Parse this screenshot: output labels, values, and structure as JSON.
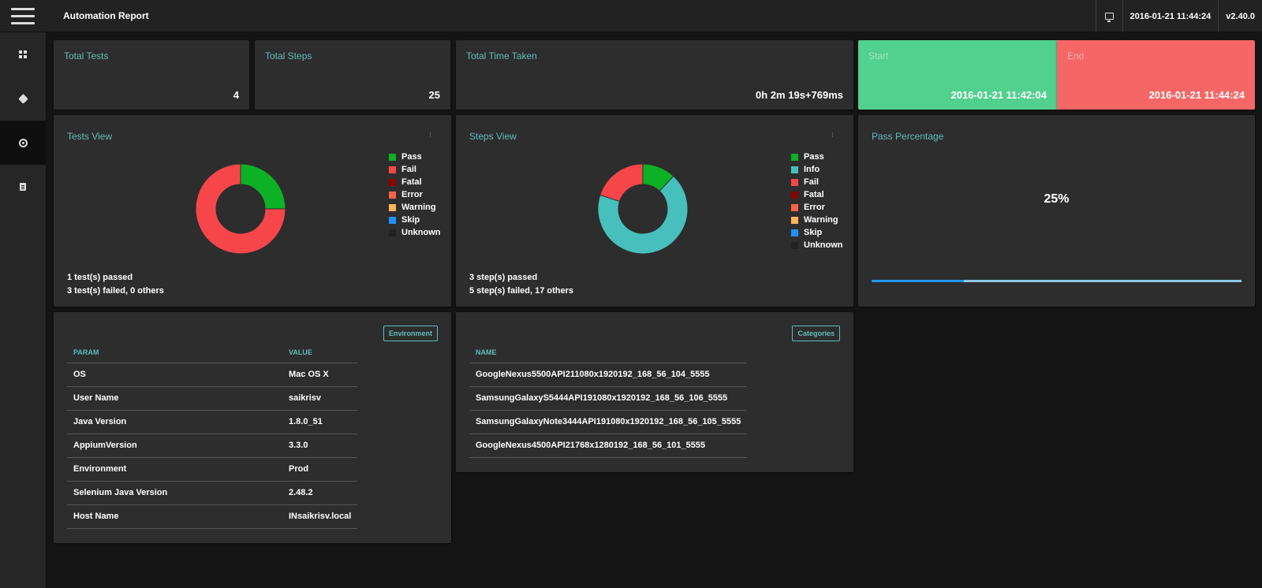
{
  "header": {
    "title": "Automation Report",
    "datetime": "2016-01-21 11:44:24",
    "version": "v2.40.0"
  },
  "sidebar": {
    "items": [
      {
        "icon": "dashboard-icon"
      },
      {
        "icon": "tag-icon"
      },
      {
        "icon": "radar-icon",
        "active": true
      },
      {
        "icon": "document-icon"
      }
    ]
  },
  "stats": {
    "total_tests": {
      "label": "Total Tests",
      "value": "4"
    },
    "total_steps": {
      "label": "Total Steps",
      "value": "25"
    },
    "total_time": {
      "label": "Total Time Taken",
      "value": "0h 2m 19s+769ms"
    },
    "start": {
      "label": "Start",
      "value": "2016-01-21 11:42:04"
    },
    "end": {
      "label": "End",
      "value": "2016-01-21 11:44:24"
    }
  },
  "colors": {
    "pass": "#0db125",
    "info": "#46bfbd",
    "fail": "#f7464a",
    "fatal": "#8b0000",
    "error": "#ff6347",
    "warning": "#fdb45c",
    "skip": "#1e90ff",
    "unknown": "#222222",
    "accent": "#5fbdb8"
  },
  "tests_view": {
    "title": "Tests View",
    "legend": [
      "Pass",
      "Fail",
      "Fatal",
      "Error",
      "Warning",
      "Skip",
      "Unknown"
    ],
    "summary_line1": "1 test(s) passed",
    "summary_line2": "3 test(s) failed, 0 others"
  },
  "steps_view": {
    "title": "Steps View",
    "legend": [
      "Pass",
      "Info",
      "Fail",
      "Fatal",
      "Error",
      "Warning",
      "Skip",
      "Unknown"
    ],
    "summary_line1": "3 step(s) passed",
    "summary_line2": "5 step(s) failed, 17 others"
  },
  "pass_percentage": {
    "title": "Pass Percentage",
    "value_text": "25%",
    "fraction": 0.25
  },
  "chart_data": [
    {
      "type": "pie",
      "categories": [
        "Pass",
        "Fail",
        "Fatal",
        "Error",
        "Warning",
        "Skip",
        "Unknown"
      ],
      "values": [
        1,
        3,
        0,
        0,
        0,
        0,
        0
      ],
      "legend": "right"
    },
    {
      "type": "pie",
      "categories": [
        "Pass",
        "Info",
        "Fail",
        "Fatal",
        "Error",
        "Warning",
        "Skip",
        "Unknown"
      ],
      "values": [
        3,
        17,
        5,
        0,
        0,
        0,
        0,
        0
      ],
      "legend": "right"
    }
  ],
  "environment": {
    "button_label": "Environment",
    "headers": [
      "PARAM",
      "VALUE"
    ],
    "rows": [
      [
        "OS",
        "Mac OS X"
      ],
      [
        "User Name",
        "saikrisv"
      ],
      [
        "Java Version",
        "1.8.0_51"
      ],
      [
        "AppiumVersion",
        "3.3.0"
      ],
      [
        "Environment",
        "Prod"
      ],
      [
        "Selenium Java Version",
        "2.48.2"
      ],
      [
        "Host Name",
        "INsaikrisv.local"
      ]
    ]
  },
  "categories": {
    "button_label": "Categories",
    "headers": [
      "NAME"
    ],
    "rows": [
      "GoogleNexus5500API211080x1920192_168_56_104_5555",
      "SamsungGalaxyS5444API191080x1920192_168_56_106_5555",
      "SamsungGalaxyNote3444API191080x1920192_168_56_105_5555",
      "GoogleNexus4500API21768x1280192_168_56_101_5555"
    ]
  }
}
